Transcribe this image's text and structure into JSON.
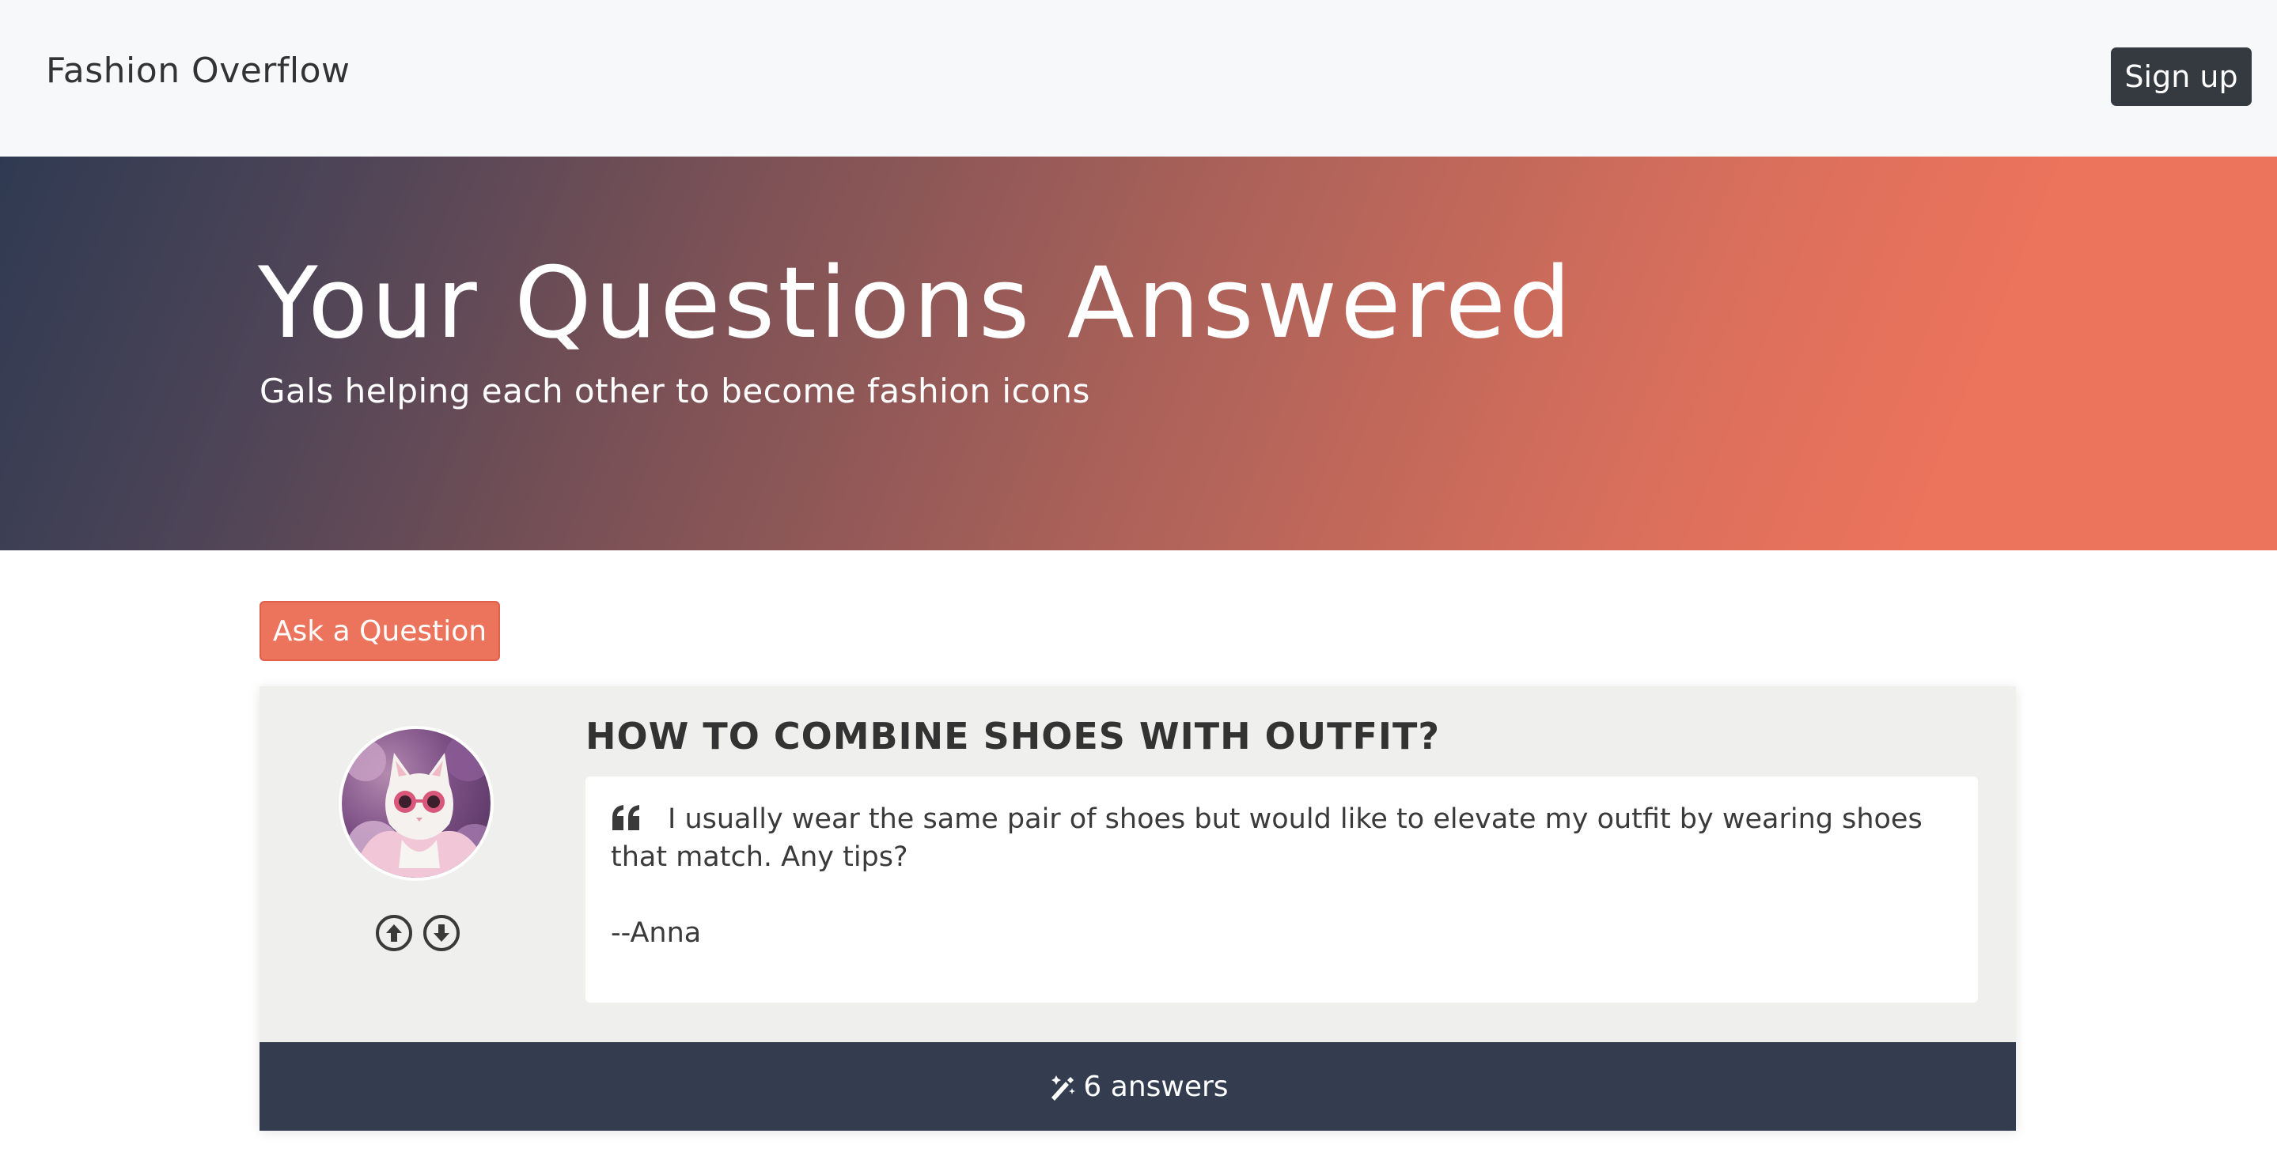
{
  "navbar": {
    "brand": "Fashion Overflow",
    "signup_label": "Sign up"
  },
  "hero": {
    "title": "Your Questions Answered",
    "subtitle": "Gals helping each other to become fashion icons",
    "gradient_colors": [
      "#2f3a52",
      "#ec735c"
    ]
  },
  "actions": {
    "ask_label": "Ask a Question",
    "ask_color": "#ec735c"
  },
  "question": {
    "title": "HOW TO COMBINE SHOES WITH OUTFIT?",
    "body": "I usually wear the same pair of shoes but would like to elevate my outfit by wearing shoes that match. Any tips?",
    "author": "--Anna",
    "avatar_icon": "cat-with-sunglasses-avatar",
    "answers_label": "6 answers",
    "answers_bar_color": "#343c4f"
  },
  "icons": {
    "upvote": "arrow-up-circle-icon",
    "downvote": "arrow-down-circle-icon",
    "quote": "quote-left-icon",
    "answers": "magic-wand-icon"
  }
}
